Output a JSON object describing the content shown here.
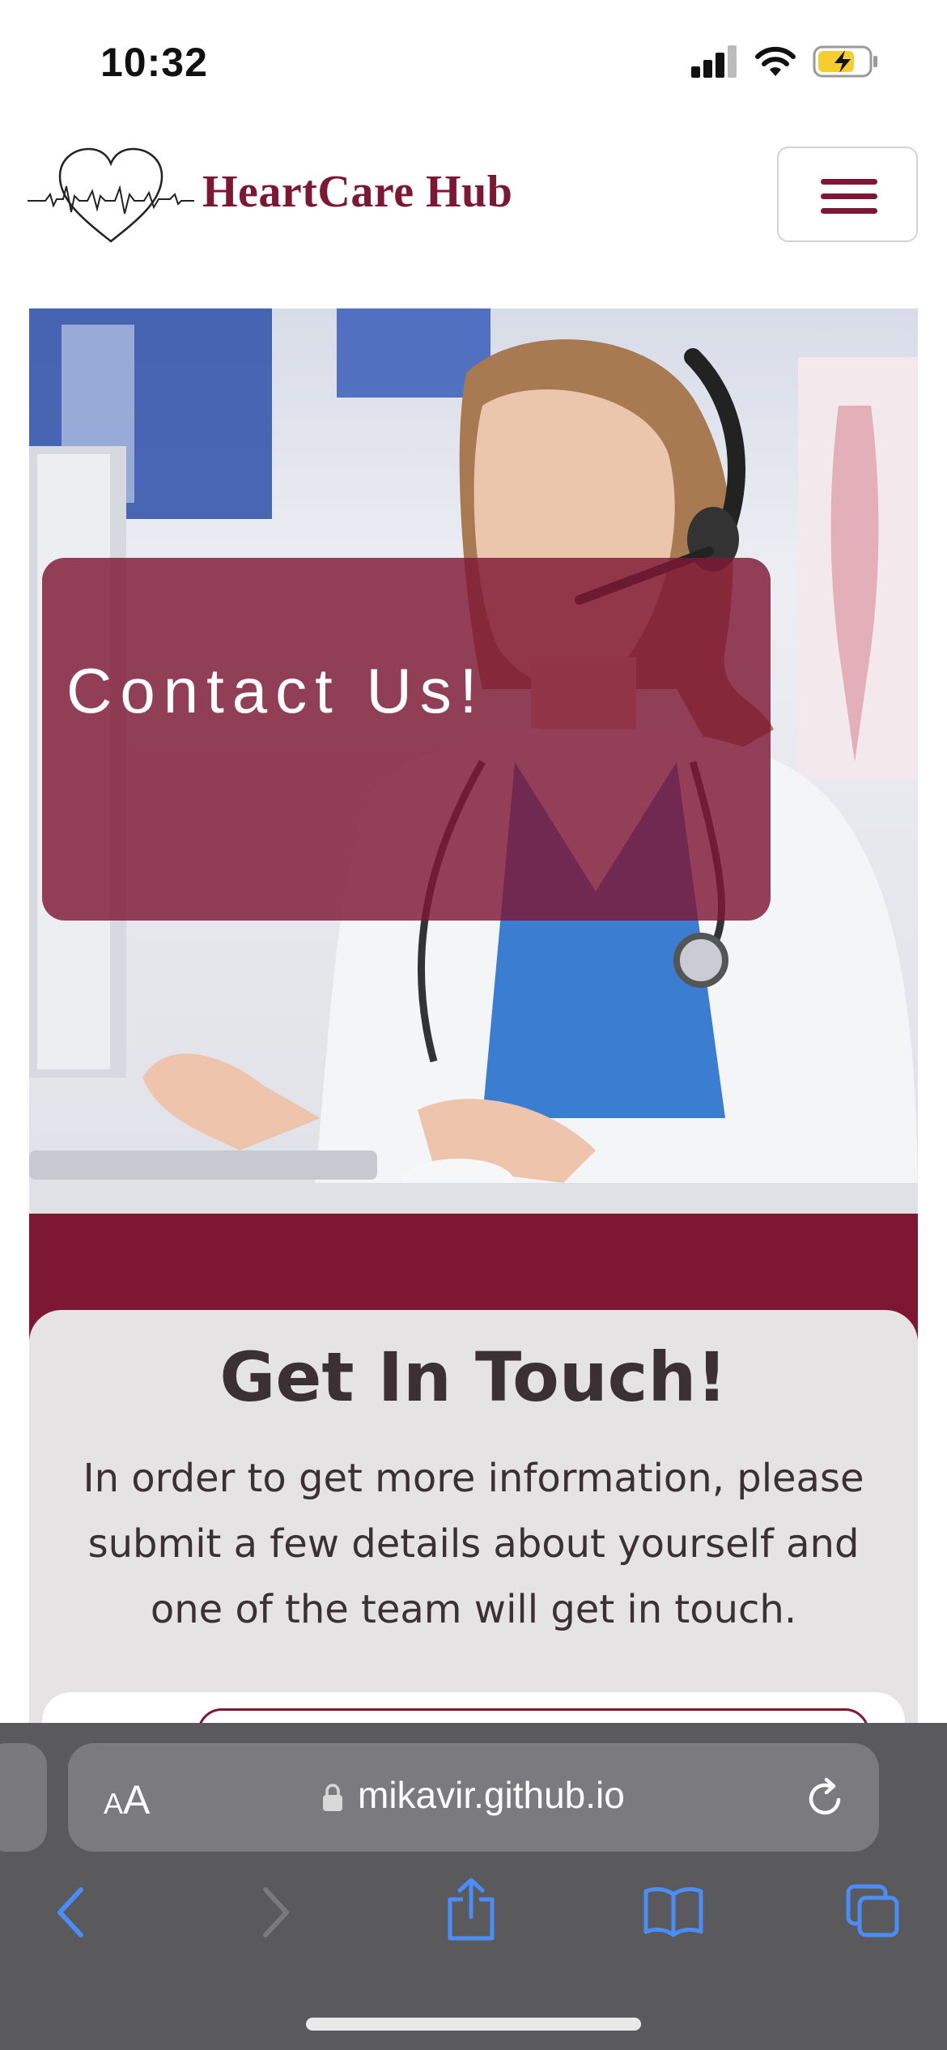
{
  "status_bar": {
    "time": "10:32"
  },
  "header": {
    "brand_name": "HeartCare Hub",
    "logo_icon": "heart-pulse-icon",
    "menu_icon": "hamburger-menu-icon"
  },
  "hero": {
    "title": "Contact Us!"
  },
  "contact": {
    "title": "Get In Touch!",
    "description": "In order to get more information, please submit a few details about yourself and one of the team will get in touch."
  },
  "browser": {
    "text_size_small": "A",
    "text_size_big": "A",
    "url": "mikavir.github.io"
  },
  "colors": {
    "brand": "#7e1734",
    "card_bg": "#e5e3e3",
    "text": "#3b3134",
    "browser_bg": "#5a5a5c",
    "browser_accent": "#4a8df8"
  }
}
